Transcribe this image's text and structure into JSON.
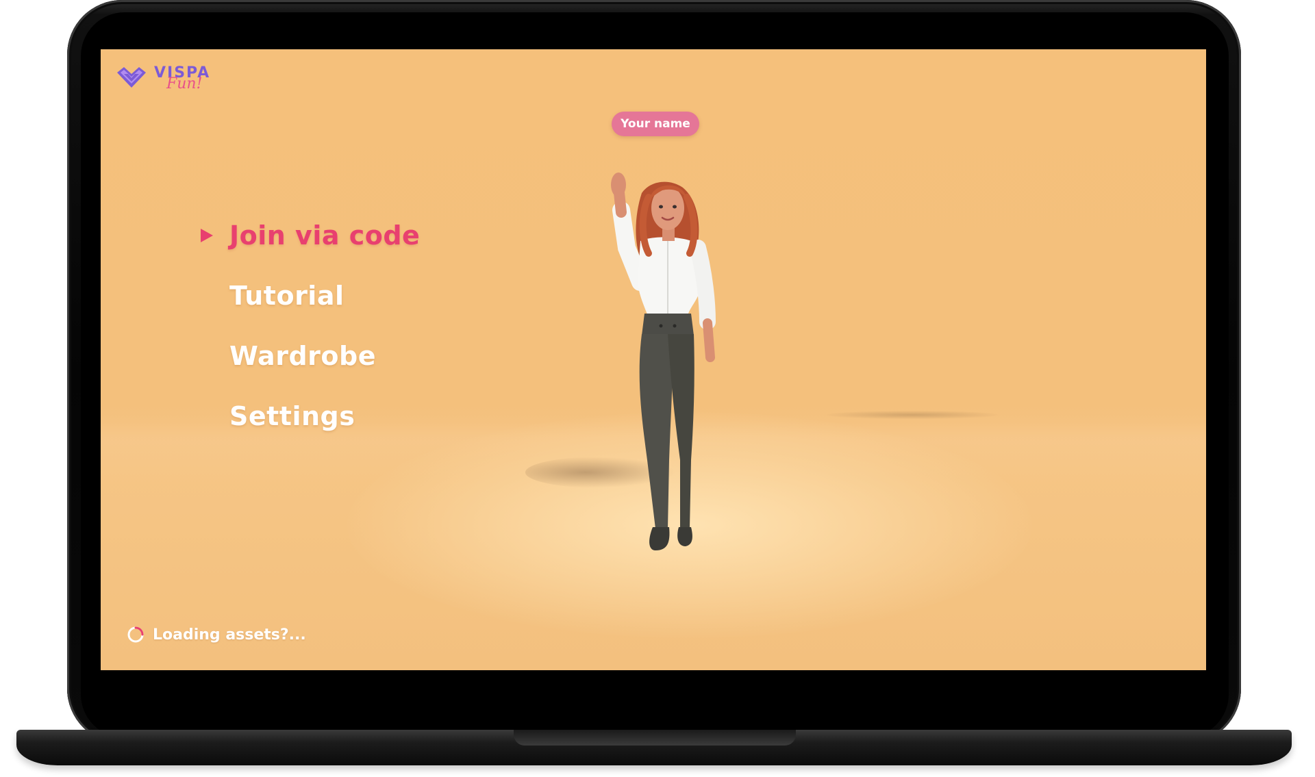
{
  "device": "laptop",
  "app": {
    "logo": {
      "word": "VISPA",
      "sub": "Fun!",
      "icon": "vispa-heart-logo-icon",
      "colors": {
        "primary": "#7c5bd6",
        "secondary": "#e8508a"
      }
    },
    "name_pill": {
      "label": "Your name",
      "color": "#e57697"
    },
    "menu": {
      "items": [
        {
          "label": "Join via code",
          "active": true
        },
        {
          "label": "Tutorial",
          "active": false
        },
        {
          "label": "Wardrobe",
          "active": false
        },
        {
          "label": "Settings",
          "active": false
        }
      ],
      "active_color": "#e8406f",
      "selector_icon": "play-triangle-icon"
    },
    "status": {
      "loading_text": "Loading assets?...",
      "icon": "loading-spinner-icon"
    },
    "avatar": {
      "icon": "waving-avatar-figure"
    },
    "colors": {
      "background": "#f4c07c",
      "text": "#ffffff"
    }
  }
}
